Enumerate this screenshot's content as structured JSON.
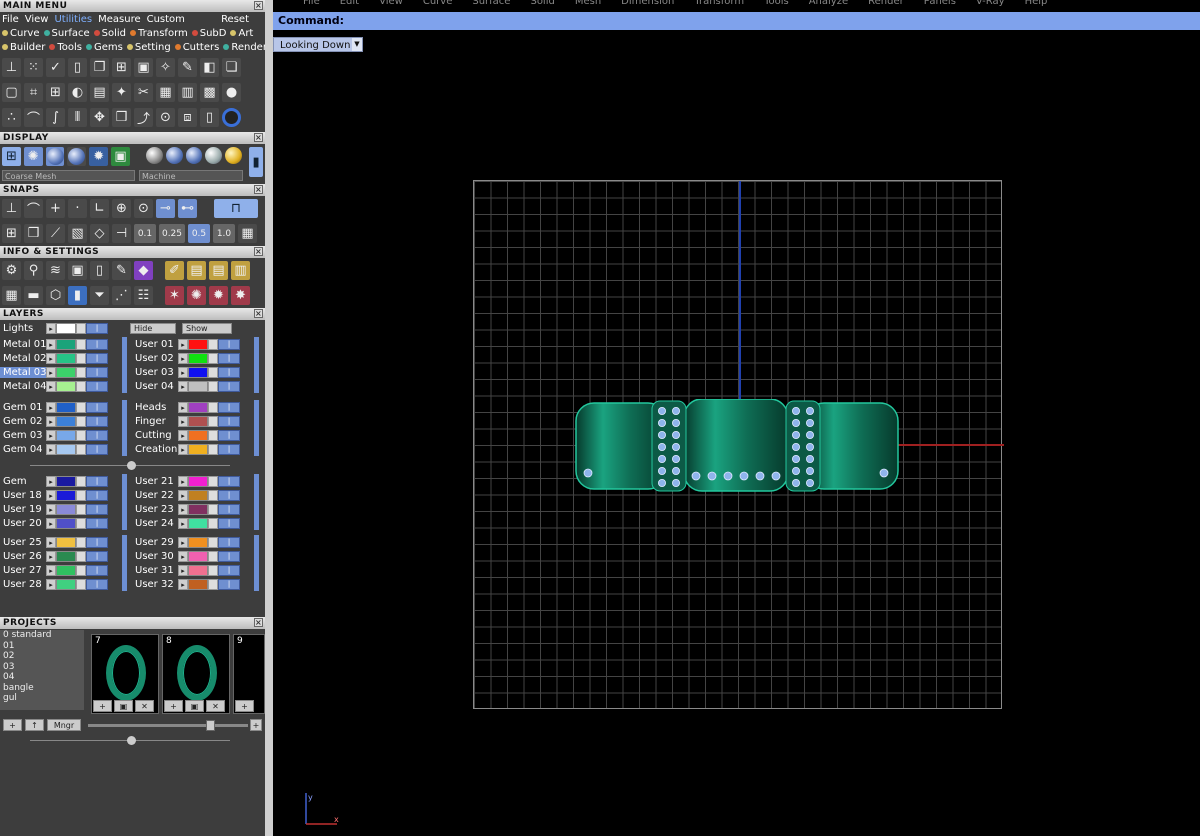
{
  "main_menu": {
    "title": "MAIN MENU",
    "menubar": [
      "File",
      "View",
      "Utilities",
      "Measure",
      "Custom"
    ],
    "reset": "Reset",
    "modules_row1": [
      {
        "label": "Curve",
        "color": "#d7c46a"
      },
      {
        "label": "Surface",
        "color": "#3fb0a0"
      },
      {
        "label": "Solid",
        "color": "#d24b3e"
      },
      {
        "label": "Transform",
        "color": "#e07a2e"
      },
      {
        "label": "SubD",
        "color": "#d24b3e"
      },
      {
        "label": "Art",
        "color": "#d7c46a"
      }
    ],
    "modules_row2": [
      {
        "label": "Builder",
        "color": "#d7c46a"
      },
      {
        "label": "Tools",
        "color": "#d24b3e"
      },
      {
        "label": "Gems",
        "color": "#3fb0a0"
      },
      {
        "label": "Setting",
        "color": "#d7c46a"
      },
      {
        "label": "Cutters",
        "color": "#e07a2e"
      },
      {
        "label": "Render",
        "color": "#3fb0a0"
      }
    ]
  },
  "display": {
    "title": "DISPLAY",
    "mesh_option": "Coarse Mesh",
    "material_option": "Machine"
  },
  "snaps": {
    "title": "SNAPS",
    "values": [
      "0.1",
      "0.25",
      "0.5",
      "1.0"
    ]
  },
  "info": {
    "title": "INFO & SETTINGS"
  },
  "layers": {
    "title": "LAYERS",
    "lights": "Lights",
    "hide": "Hide",
    "show": "Show",
    "left_groups": [
      [
        {
          "name": "Metal 01",
          "color": "#1aa37a"
        },
        {
          "name": "Metal 02",
          "color": "#26c486"
        },
        {
          "name": "Metal 03",
          "color": "#3cd06a",
          "selected": true
        },
        {
          "name": "Metal 04",
          "color": "#a6f090"
        }
      ],
      [
        {
          "name": "Gem 01",
          "color": "#2060c8"
        },
        {
          "name": "Gem 02",
          "color": "#3c80d8"
        },
        {
          "name": "Gem 03",
          "color": "#78a8e8"
        },
        {
          "name": "Gem 04",
          "color": "#a6c8f0"
        }
      ],
      [
        {
          "name": "Gem",
          "color": "#1a1aa0"
        },
        {
          "name": "User 18",
          "color": "#1a1ad8"
        },
        {
          "name": "User 19",
          "color": "#8a8ad8"
        },
        {
          "name": "User 20",
          "color": "#5050c8"
        }
      ],
      [
        {
          "name": "User 25",
          "color": "#f0c040"
        },
        {
          "name": "User 26",
          "color": "#2a8a50"
        },
        {
          "name": "User 27",
          "color": "#30c060"
        },
        {
          "name": "User 28",
          "color": "#40d080"
        }
      ]
    ],
    "right_groups": [
      [
        {
          "name": "User 01",
          "color": "#ff1010"
        },
        {
          "name": "User 02",
          "color": "#10e010"
        },
        {
          "name": "User 03",
          "color": "#1010f0"
        },
        {
          "name": "User 04",
          "color": "#c0c0c0"
        }
      ],
      [
        {
          "name": "Heads",
          "color": "#a040c0"
        },
        {
          "name": "Finger",
          "color": "#b05050"
        },
        {
          "name": "Cutting",
          "color": "#f07020"
        },
        {
          "name": "Creation",
          "color": "#f0b020"
        }
      ],
      [
        {
          "name": "User 21",
          "color": "#f020d0"
        },
        {
          "name": "User 22",
          "color": "#c08020"
        },
        {
          "name": "User 23",
          "color": "#803060"
        },
        {
          "name": "User 24",
          "color": "#40e0a0"
        }
      ],
      [
        {
          "name": "User 29",
          "color": "#f09020"
        },
        {
          "name": "User 30",
          "color": "#f060b0"
        },
        {
          "name": "User 31",
          "color": "#f07090"
        },
        {
          "name": "User 32",
          "color": "#c06020"
        }
      ]
    ]
  },
  "projects": {
    "title": "PROJECTS",
    "items": [
      "0 standard",
      "01",
      "02",
      "03",
      "04",
      "bangle",
      "gul"
    ],
    "thumb_numbers": [
      "7",
      "8",
      "9"
    ],
    "manager": "Mngr"
  },
  "viewport": {
    "top_menu": [
      "File",
      "Edit",
      "View",
      "Curve",
      "Surface",
      "Solid",
      "Mesh",
      "Dimension",
      "Transform",
      "Tools",
      "Analyze",
      "Render",
      "Panels",
      "V-Ray",
      "Help"
    ],
    "command_label": "Command:",
    "view_name": "Looking Down",
    "ucs_y": "y",
    "ucs_x": "x"
  }
}
